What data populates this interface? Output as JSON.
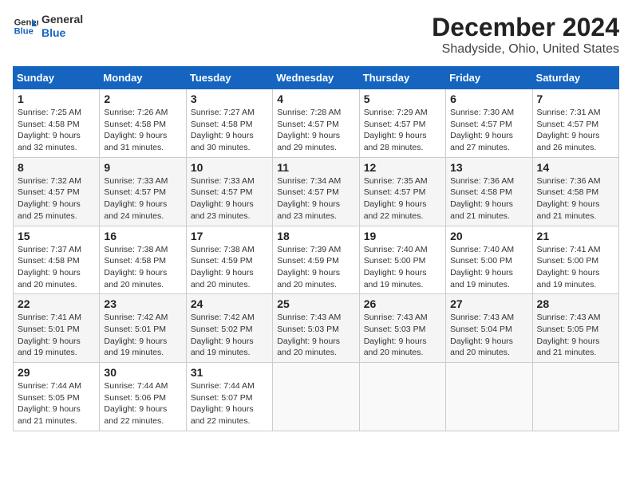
{
  "header": {
    "logo_line1": "General",
    "logo_line2": "Blue",
    "main_title": "December 2024",
    "subtitle": "Shadyside, Ohio, United States"
  },
  "columns": [
    "Sunday",
    "Monday",
    "Tuesday",
    "Wednesday",
    "Thursday",
    "Friday",
    "Saturday"
  ],
  "weeks": [
    [
      {
        "num": "1",
        "rise": "7:25 AM",
        "set": "4:58 PM",
        "daylight": "9 hours and 32 minutes."
      },
      {
        "num": "2",
        "rise": "7:26 AM",
        "set": "4:58 PM",
        "daylight": "9 hours and 31 minutes."
      },
      {
        "num": "3",
        "rise": "7:27 AM",
        "set": "4:58 PM",
        "daylight": "9 hours and 30 minutes."
      },
      {
        "num": "4",
        "rise": "7:28 AM",
        "set": "4:57 PM",
        "daylight": "9 hours and 29 minutes."
      },
      {
        "num": "5",
        "rise": "7:29 AM",
        "set": "4:57 PM",
        "daylight": "9 hours and 28 minutes."
      },
      {
        "num": "6",
        "rise": "7:30 AM",
        "set": "4:57 PM",
        "daylight": "9 hours and 27 minutes."
      },
      {
        "num": "7",
        "rise": "7:31 AM",
        "set": "4:57 PM",
        "daylight": "9 hours and 26 minutes."
      }
    ],
    [
      {
        "num": "8",
        "rise": "7:32 AM",
        "set": "4:57 PM",
        "daylight": "9 hours and 25 minutes."
      },
      {
        "num": "9",
        "rise": "7:33 AM",
        "set": "4:57 PM",
        "daylight": "9 hours and 24 minutes."
      },
      {
        "num": "10",
        "rise": "7:33 AM",
        "set": "4:57 PM",
        "daylight": "9 hours and 23 minutes."
      },
      {
        "num": "11",
        "rise": "7:34 AM",
        "set": "4:57 PM",
        "daylight": "9 hours and 23 minutes."
      },
      {
        "num": "12",
        "rise": "7:35 AM",
        "set": "4:57 PM",
        "daylight": "9 hours and 22 minutes."
      },
      {
        "num": "13",
        "rise": "7:36 AM",
        "set": "4:58 PM",
        "daylight": "9 hours and 21 minutes."
      },
      {
        "num": "14",
        "rise": "7:36 AM",
        "set": "4:58 PM",
        "daylight": "9 hours and 21 minutes."
      }
    ],
    [
      {
        "num": "15",
        "rise": "7:37 AM",
        "set": "4:58 PM",
        "daylight": "9 hours and 20 minutes."
      },
      {
        "num": "16",
        "rise": "7:38 AM",
        "set": "4:58 PM",
        "daylight": "9 hours and 20 minutes."
      },
      {
        "num": "17",
        "rise": "7:38 AM",
        "set": "4:59 PM",
        "daylight": "9 hours and 20 minutes."
      },
      {
        "num": "18",
        "rise": "7:39 AM",
        "set": "4:59 PM",
        "daylight": "9 hours and 20 minutes."
      },
      {
        "num": "19",
        "rise": "7:40 AM",
        "set": "5:00 PM",
        "daylight": "9 hours and 19 minutes."
      },
      {
        "num": "20",
        "rise": "7:40 AM",
        "set": "5:00 PM",
        "daylight": "9 hours and 19 minutes."
      },
      {
        "num": "21",
        "rise": "7:41 AM",
        "set": "5:00 PM",
        "daylight": "9 hours and 19 minutes."
      }
    ],
    [
      {
        "num": "22",
        "rise": "7:41 AM",
        "set": "5:01 PM",
        "daylight": "9 hours and 19 minutes."
      },
      {
        "num": "23",
        "rise": "7:42 AM",
        "set": "5:01 PM",
        "daylight": "9 hours and 19 minutes."
      },
      {
        "num": "24",
        "rise": "7:42 AM",
        "set": "5:02 PM",
        "daylight": "9 hours and 19 minutes."
      },
      {
        "num": "25",
        "rise": "7:43 AM",
        "set": "5:03 PM",
        "daylight": "9 hours and 20 minutes."
      },
      {
        "num": "26",
        "rise": "7:43 AM",
        "set": "5:03 PM",
        "daylight": "9 hours and 20 minutes."
      },
      {
        "num": "27",
        "rise": "7:43 AM",
        "set": "5:04 PM",
        "daylight": "9 hours and 20 minutes."
      },
      {
        "num": "28",
        "rise": "7:43 AM",
        "set": "5:05 PM",
        "daylight": "9 hours and 21 minutes."
      }
    ],
    [
      {
        "num": "29",
        "rise": "7:44 AM",
        "set": "5:05 PM",
        "daylight": "9 hours and 21 minutes."
      },
      {
        "num": "30",
        "rise": "7:44 AM",
        "set": "5:06 PM",
        "daylight": "9 hours and 22 minutes."
      },
      {
        "num": "31",
        "rise": "7:44 AM",
        "set": "5:07 PM",
        "daylight": "9 hours and 22 minutes."
      },
      null,
      null,
      null,
      null
    ]
  ]
}
